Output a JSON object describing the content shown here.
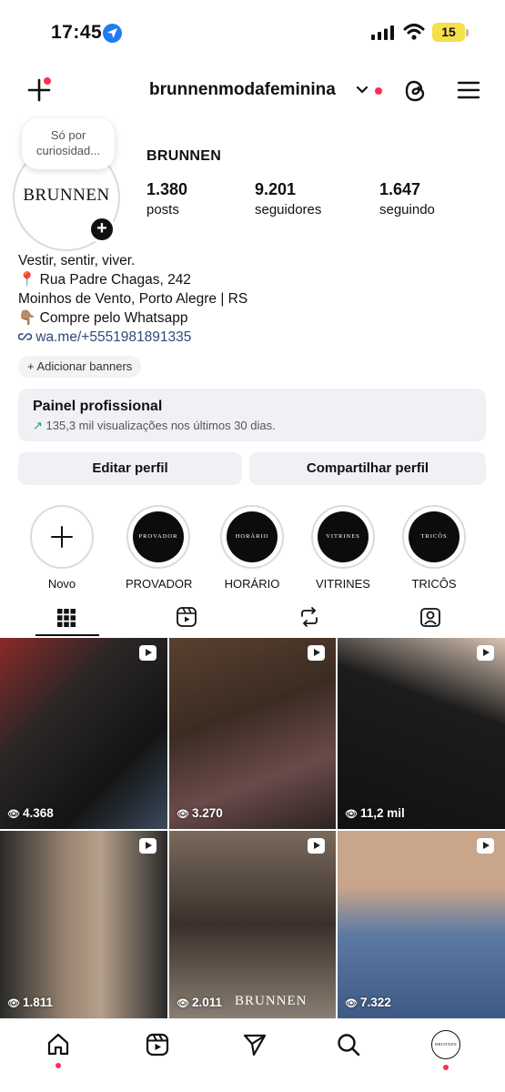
{
  "status_bar": {
    "time": "17:45",
    "battery": "15"
  },
  "header": {
    "username": "brunnenmodafeminina"
  },
  "profile": {
    "note": "Só por curiosidad...",
    "avatar_logo": "BRUNNEN",
    "display_name": "BRUNNEN",
    "stats": [
      {
        "value": "1.380",
        "label": "posts"
      },
      {
        "value": "9.201",
        "label": "seguidores"
      },
      {
        "value": "1.647",
        "label": "seguindo"
      }
    ],
    "bio": {
      "line1": "Vestir, sentir, viver.",
      "line2": "Rua Padre Chagas, 242",
      "line3": "Moinhos de Vento, Porto Alegre | RS",
      "line4": "Compre pelo Whatsapp",
      "link": "wa.me/+5551981891335"
    },
    "add_banners": "Adicionar banners"
  },
  "dashboard": {
    "title": "Painel profissional",
    "subtitle": "135,3 mil visualizações nos últimos 30 dias."
  },
  "actions": {
    "edit": "Editar perfil",
    "share": "Compartilhar perfil"
  },
  "highlights": [
    {
      "label": "Novo",
      "cover": ""
    },
    {
      "label": "PROVADOR",
      "cover": "PROVADOR"
    },
    {
      "label": "HORÁRIO",
      "cover": "HORÁRIO"
    },
    {
      "label": "VITRINES",
      "cover": "VITRINES"
    },
    {
      "label": "TRICÔS",
      "cover": "TRICÔS"
    }
  ],
  "posts": [
    {
      "views": "4.368",
      "reel": true,
      "bg": "#3a3030"
    },
    {
      "views": "3.270",
      "reel": true,
      "bg": "#4a3b33"
    },
    {
      "views": "11,2 mil",
      "reel": true,
      "bg": "#1a1a1a"
    },
    {
      "views": "1.811",
      "reel": true,
      "bg": "#6b5a4c"
    },
    {
      "views": "2.011",
      "reel": true,
      "bg": "#5b4e44",
      "watermark": "BRUNNEN"
    },
    {
      "views": "7.322",
      "reel": true,
      "bg": "#7c8fa8"
    }
  ],
  "colors": {
    "accent": "#1e7cf2",
    "notification": "#ff2d55",
    "link": "#2d4a7a",
    "trend": "#1aa05a"
  }
}
